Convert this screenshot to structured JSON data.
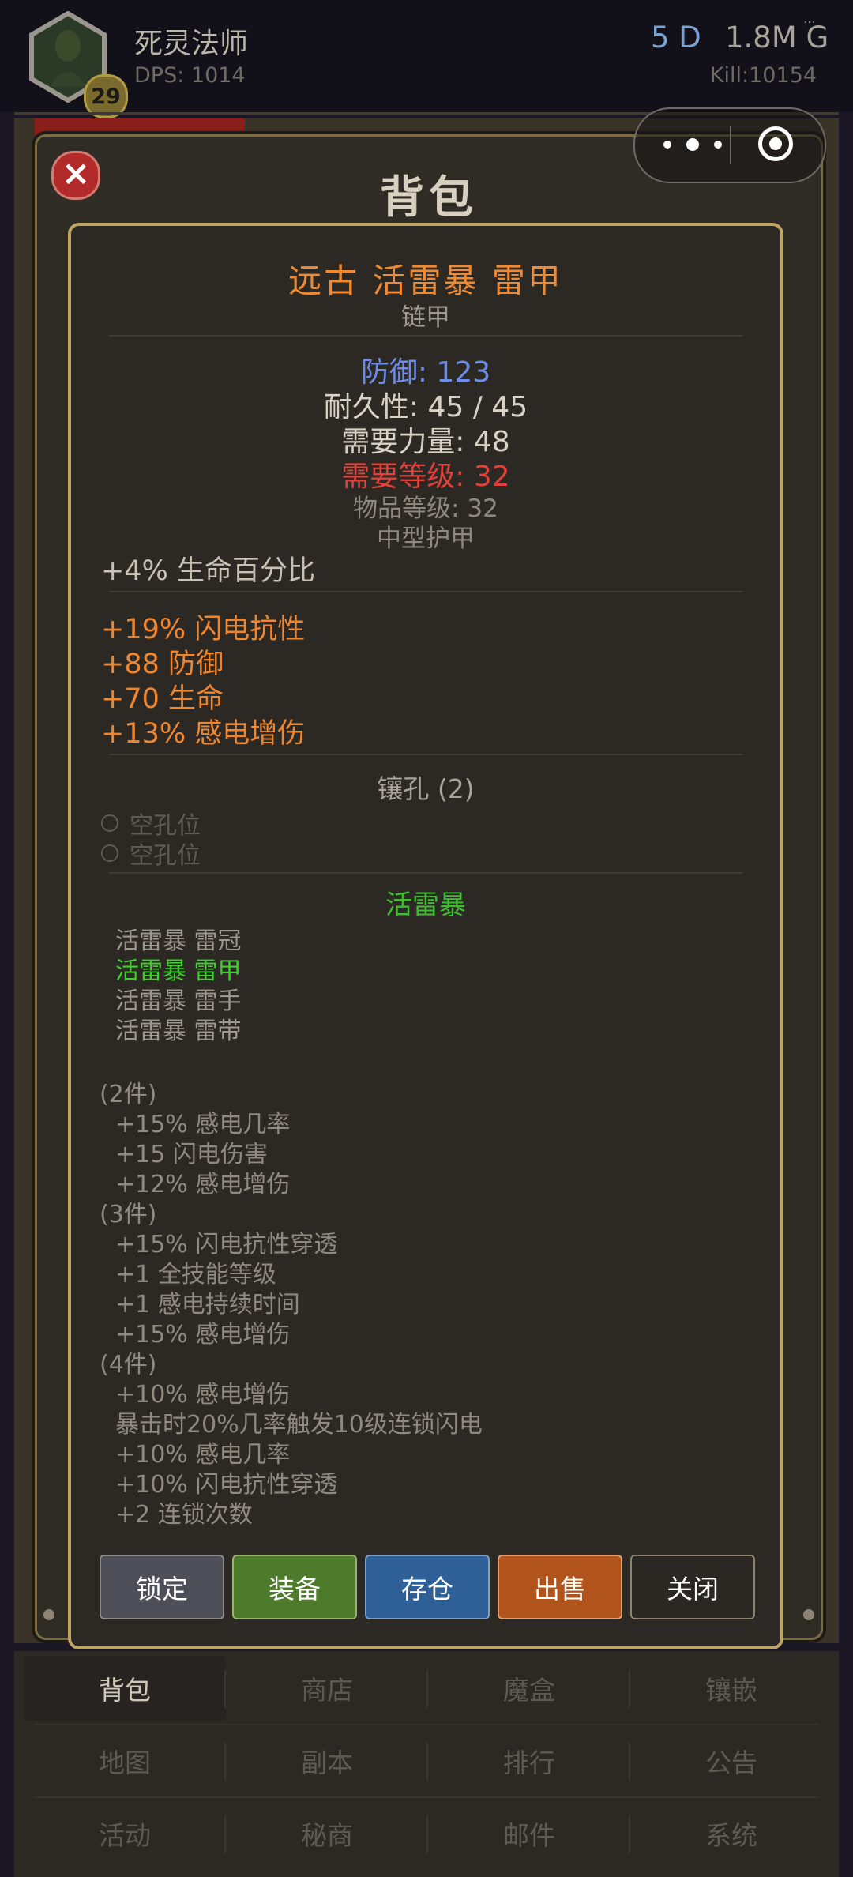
{
  "header": {
    "character_name": "死灵法师",
    "level": "29",
    "dps": "DPS: 1014",
    "days": "5 D",
    "gold": "1.8M G",
    "kill": "Kill:10154"
  },
  "backpack": {
    "title": "背包"
  },
  "item": {
    "name": "远古 活雷暴 雷甲",
    "type": "链甲",
    "defense": "防御: 123",
    "durability": "耐久性: 45 / 45",
    "req_strength": "需要力量: 48",
    "req_level": "需要等级: 32",
    "item_level": "物品等级: 32",
    "armor_class": "中型护甲",
    "implicit": "+4% 生命百分比",
    "affixes": [
      "+19% 闪电抗性",
      "+88 防御",
      "+70 生命",
      "+13% 感电增伤"
    ],
    "sockets_title": "镶孔 (2)",
    "sockets": [
      "空孔位",
      "空孔位"
    ],
    "set": {
      "title": "活雷暴",
      "pieces": [
        "活雷暴 雷冠",
        "活雷暴 雷甲",
        "活雷暴 雷手",
        "活雷暴 雷带"
      ],
      "active_index": 1,
      "bonuses": [
        {
          "header": "(2件)",
          "lines": [
            "+15% 感电几率",
            "+15 闪电伤害",
            "+12% 感电增伤"
          ]
        },
        {
          "header": "(3件)",
          "lines": [
            "+15% 闪电抗性穿透",
            "+1 全技能等级",
            "+1 感电持续时间",
            "+15% 感电增伤"
          ]
        },
        {
          "header": "(4件)",
          "lines": [
            "+10% 感电增伤",
            "暴击时20%几率触发10级连锁闪电",
            "+10% 感电几率",
            "+10% 闪电抗性穿透",
            "+2 连锁次数"
          ]
        }
      ]
    }
  },
  "actions": {
    "lock": "锁定",
    "equip": "装备",
    "stash": "存仓",
    "sell": "出售",
    "close": "关闭"
  },
  "nav": {
    "row1": [
      "背包",
      "商店",
      "魔盒",
      "镶嵌"
    ],
    "row2": [
      "地图",
      "副本",
      "排行",
      "公告"
    ],
    "row3": [
      "活动",
      "秘商",
      "邮件",
      "系统"
    ],
    "active": "背包"
  }
}
